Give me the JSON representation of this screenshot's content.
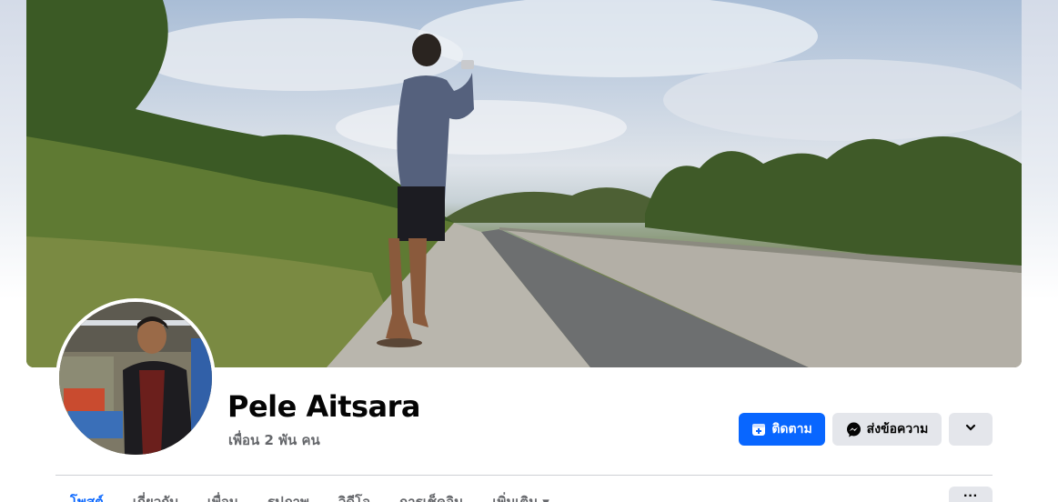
{
  "profile": {
    "name": "Pele Aitsara",
    "friends": "เพื่อน 2 พัน คน"
  },
  "actions": {
    "follow_label": "ติดตาม",
    "message_label": "ส่งข้อความ",
    "more_icon": "chevron-down-icon"
  },
  "tabs": [
    {
      "label": "โพสต์",
      "active": true
    },
    {
      "label": "เกี่ยวกับ",
      "active": false
    },
    {
      "label": "เพื่อน",
      "active": false
    },
    {
      "label": "รูปภาพ",
      "active": false
    },
    {
      "label": "วิดีโอ",
      "active": false
    },
    {
      "label": "การเช็คอิน",
      "active": false
    },
    {
      "label": "เพิ่มเติม ▾",
      "active": false
    }
  ],
  "tab_overflow": "···",
  "colors": {
    "primary": "#0866ff",
    "secondary_button": "#e4e6eb",
    "text_primary": "#050505",
    "text_secondary": "#65676b"
  }
}
